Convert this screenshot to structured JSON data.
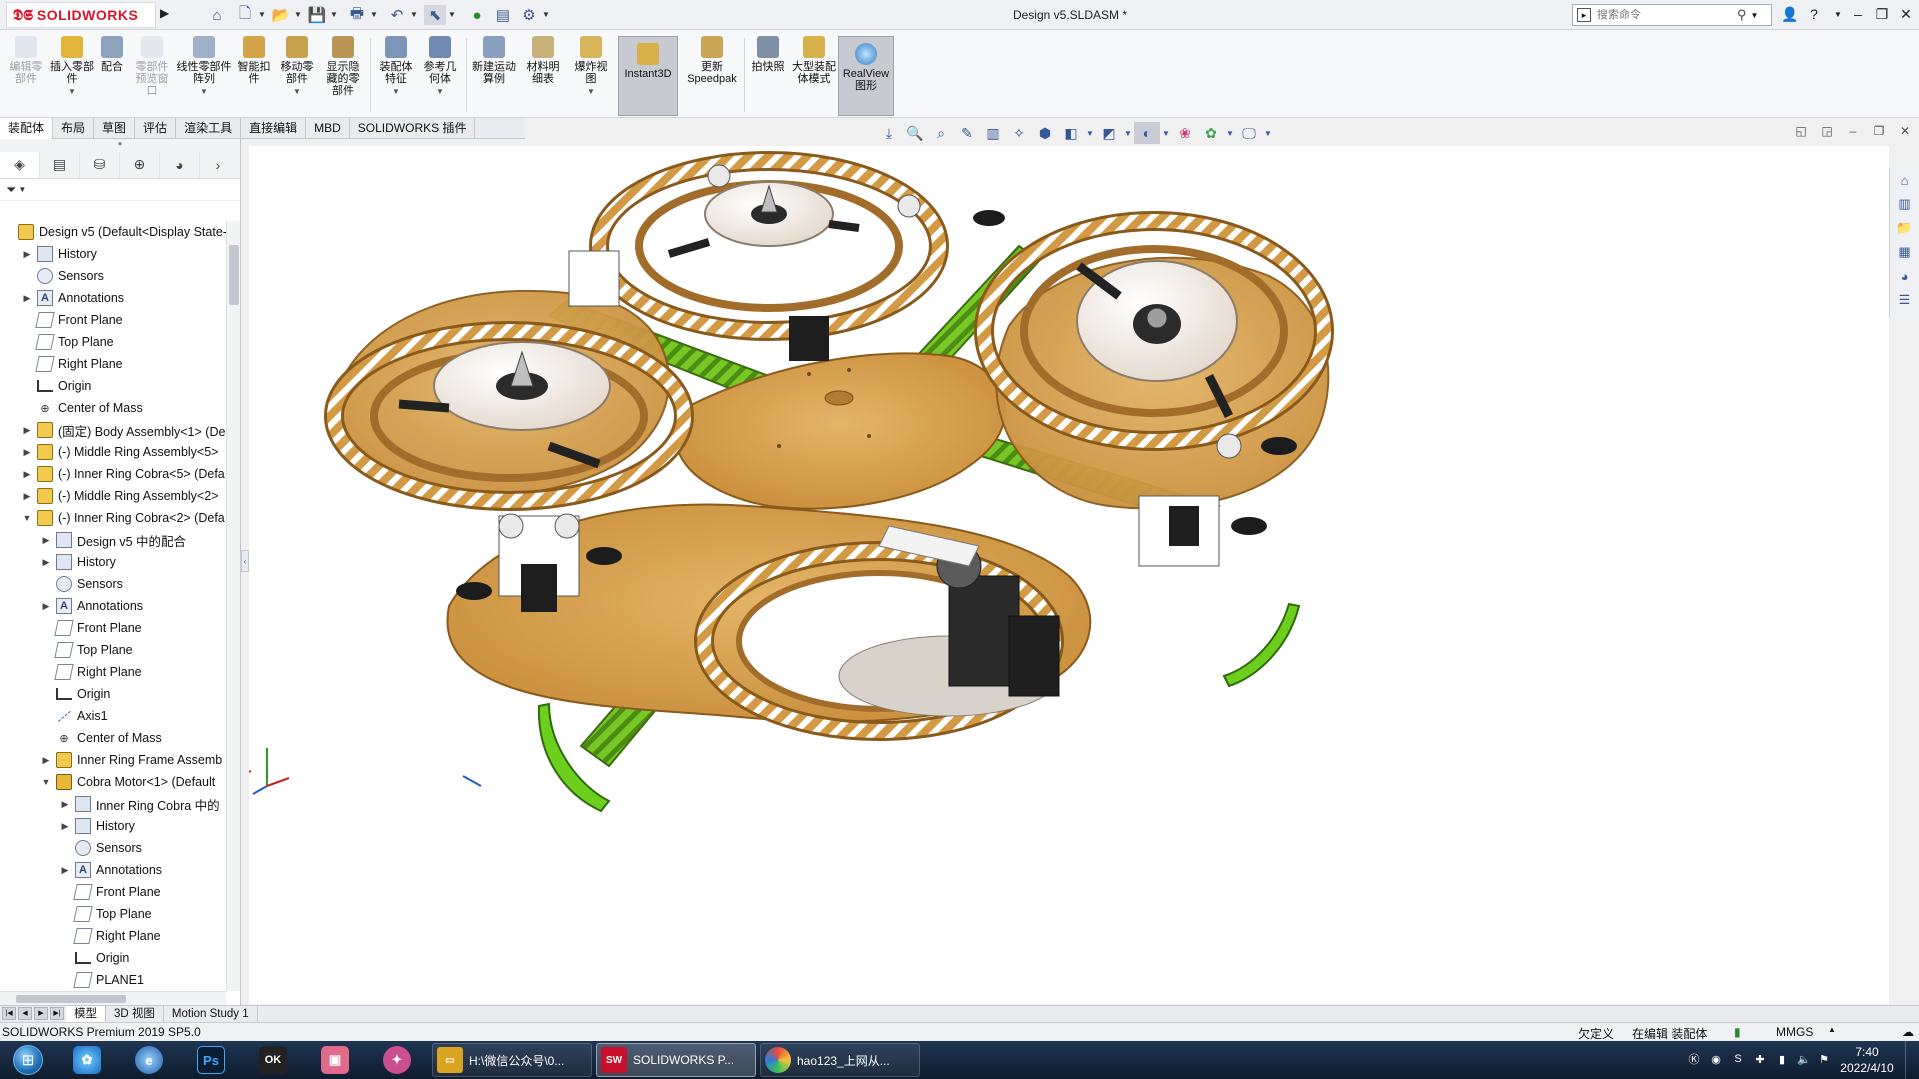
{
  "app": {
    "brand": "SOLIDWORKS",
    "document_title": "Design v5.SLDASM *",
    "search_placeholder": "搜索命令"
  },
  "ribbon": {
    "buttons": [
      {
        "label": "编辑零部件",
        "icon": "edit-component-icon",
        "disabled": true
      },
      {
        "label": "插入零部件",
        "icon": "insert-component-icon",
        "disabled": false
      },
      {
        "label": "配合",
        "icon": "mate-icon",
        "disabled": false
      },
      {
        "label": "零部件预览窗口",
        "icon": "component-preview-icon",
        "disabled": true
      },
      {
        "label": "线性零部件阵列",
        "icon": "linear-pattern-icon",
        "disabled": false
      },
      {
        "label": "智能扣件",
        "icon": "smart-fasteners-icon",
        "disabled": false
      },
      {
        "label": "移动零部件",
        "icon": "move-component-icon",
        "disabled": false
      },
      {
        "label": "显示隐藏的零部件",
        "icon": "show-hidden-icon",
        "disabled": false
      },
      {
        "label": "装配体特征",
        "icon": "assembly-features-icon",
        "disabled": false
      },
      {
        "label": "参考几何体",
        "icon": "reference-geometry-icon",
        "disabled": false
      },
      {
        "label": "新建运动算例",
        "icon": "new-motion-study-icon",
        "disabled": false
      },
      {
        "label": "材料明细表",
        "icon": "bom-icon",
        "disabled": false
      },
      {
        "label": "爆炸视图",
        "icon": "exploded-view-icon",
        "disabled": false
      },
      {
        "label": "Instant3D",
        "icon": "instant3d-icon",
        "disabled": false,
        "active": true
      },
      {
        "label": "更新Speedpak",
        "icon": "speedpak-icon",
        "disabled": false
      },
      {
        "label": "拍快照",
        "icon": "snapshot-icon",
        "disabled": false
      },
      {
        "label": "大型装配体模式",
        "icon": "large-assembly-icon",
        "disabled": false
      },
      {
        "label": "RealView图形",
        "icon": "realview-icon",
        "disabled": false,
        "active": true
      }
    ]
  },
  "tabs": [
    "装配体",
    "布局",
    "草图",
    "评估",
    "渲染工具",
    "直接编辑",
    "MBD",
    "SOLIDWORKS 插件"
  ],
  "tree": [
    {
      "label": "Design v5  (Default<Display State-",
      "level": 0,
      "exp": "",
      "icon": "assy"
    },
    {
      "label": "History",
      "level": 1,
      "exp": "▶",
      "icon": "folder"
    },
    {
      "label": "Sensors",
      "level": 1,
      "exp": "",
      "icon": "sensor"
    },
    {
      "label": "Annotations",
      "level": 1,
      "exp": "▶",
      "icon": "anno"
    },
    {
      "label": "Front Plane",
      "level": 1,
      "exp": "",
      "icon": "plane"
    },
    {
      "label": "Top Plane",
      "level": 1,
      "exp": "",
      "icon": "plane"
    },
    {
      "label": "Right Plane",
      "level": 1,
      "exp": "",
      "icon": "plane"
    },
    {
      "label": "Origin",
      "level": 1,
      "exp": "",
      "icon": "origin"
    },
    {
      "label": "Center of Mass",
      "level": 1,
      "exp": "",
      "icon": "mass"
    },
    {
      "label": "(固定) Body Assembly<1> (De",
      "level": 1,
      "exp": "▶",
      "icon": "assy"
    },
    {
      "label": "(-) Middle Ring Assembly<5>",
      "level": 1,
      "exp": "▶",
      "icon": "assy"
    },
    {
      "label": "(-) Inner Ring Cobra<5> (Defa",
      "level": 1,
      "exp": "▶",
      "icon": "assy"
    },
    {
      "label": "(-) Middle Ring Assembly<2>",
      "level": 1,
      "exp": "▶",
      "icon": "assy"
    },
    {
      "label": "(-) Inner Ring Cobra<2> (Defa",
      "level": 1,
      "exp": "▼",
      "icon": "assy"
    },
    {
      "label": "Design v5 中的配合",
      "level": 2,
      "exp": "▶",
      "icon": "mate"
    },
    {
      "label": "History",
      "level": 2,
      "exp": "▶",
      "icon": "folder"
    },
    {
      "label": "Sensors",
      "level": 2,
      "exp": "",
      "icon": "sensor"
    },
    {
      "label": "Annotations",
      "level": 2,
      "exp": "▶",
      "icon": "anno"
    },
    {
      "label": "Front Plane",
      "level": 2,
      "exp": "",
      "icon": "plane"
    },
    {
      "label": "Top Plane",
      "level": 2,
      "exp": "",
      "icon": "plane"
    },
    {
      "label": "Right Plane",
      "level": 2,
      "exp": "",
      "icon": "plane"
    },
    {
      "label": "Origin",
      "level": 2,
      "exp": "",
      "icon": "origin"
    },
    {
      "label": "Axis1",
      "level": 2,
      "exp": "",
      "icon": "axis"
    },
    {
      "label": "Center of Mass",
      "level": 2,
      "exp": "",
      "icon": "mass"
    },
    {
      "label": "Inner Ring Frame Assemb",
      "level": 2,
      "exp": "▶",
      "icon": "assy"
    },
    {
      "label": "Cobra Motor<1> (Default",
      "level": 2,
      "exp": "▼",
      "icon": "part"
    },
    {
      "label": "Inner Ring Cobra 中的",
      "level": 3,
      "exp": "▶",
      "icon": "mate"
    },
    {
      "label": "History",
      "level": 3,
      "exp": "▶",
      "icon": "folder"
    },
    {
      "label": "Sensors",
      "level": 3,
      "exp": "",
      "icon": "sensor"
    },
    {
      "label": "Annotations",
      "level": 3,
      "exp": "▶",
      "icon": "anno"
    },
    {
      "label": "Front Plane",
      "level": 3,
      "exp": "",
      "icon": "plane"
    },
    {
      "label": "Top Plane",
      "level": 3,
      "exp": "",
      "icon": "plane"
    },
    {
      "label": "Right Plane",
      "level": 3,
      "exp": "",
      "icon": "plane"
    },
    {
      "label": "Origin",
      "level": 3,
      "exp": "",
      "icon": "origin"
    },
    {
      "label": "PLANE1",
      "level": 3,
      "exp": "",
      "icon": "plane"
    }
  ],
  "bottom_tabs": [
    "模型",
    "3D 视图",
    "Motion Study 1"
  ],
  "status": {
    "left": "SOLIDWORKS Premium 2019 SP5.0",
    "underdefined": "欠定义",
    "editing": "在编辑 装配体",
    "units": "MMGS"
  },
  "taskbar": {
    "windows": [
      {
        "label": "H:\\微信公众号\\0...",
        "icon": "folder-icon",
        "color": "#d9a520"
      },
      {
        "label": "SOLIDWORKS P...",
        "icon": "solidworks-icon",
        "color": "#c8102e",
        "active": true
      },
      {
        "label": "hao123_上网从...",
        "icon": "browser-icon",
        "color": "#2e7bd6"
      }
    ],
    "time": "7:40",
    "date": "2022/4/10"
  },
  "colors": {
    "wood": "#d9a24a",
    "wood_dark": "#8a5a1c",
    "arm_green": "#7ed321",
    "accent_red": "#d6162a"
  }
}
